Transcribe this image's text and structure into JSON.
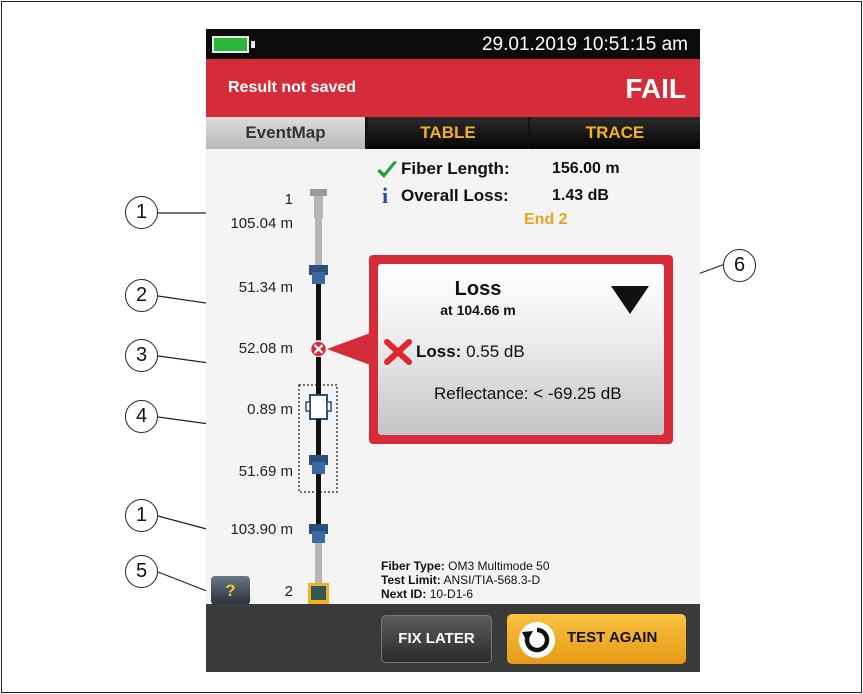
{
  "status": {
    "datetime": "29.01.2019 10:51:15 am",
    "battery_color": "#2bb53a"
  },
  "header": {
    "result_label": "Result not saved",
    "status_label": "FAIL",
    "status_color": "#d62c3a"
  },
  "tabs": [
    {
      "label": "EventMap",
      "active": true
    },
    {
      "label": "TABLE",
      "active": false
    },
    {
      "label": "TRACE",
      "active": false
    }
  ],
  "summary": {
    "fiber_length_label": "Fiber Length:",
    "fiber_length_value": "156.00 m",
    "overall_loss_label": "Overall Loss:",
    "overall_loss_value": "1.43 dB",
    "end_label": "End 2"
  },
  "event_map": {
    "top_end_number": "1",
    "bottom_end_number": "2",
    "segments": [
      "105.04 m",
      "51.34 m",
      "52.08 m",
      "0.89 m",
      "51.69 m",
      "103.90 m"
    ]
  },
  "event_popup": {
    "title": "Loss",
    "subtitle": "at 104.66 m",
    "loss_label": "Loss:",
    "loss_value": "0.55 dB",
    "reflectance": "Reflectance: < -69.25 dB"
  },
  "fiber_info": {
    "type_label": "Fiber Type:",
    "type_value": "OM3 Multimode 50",
    "limit_label": "Test Limit:",
    "limit_value": "ANSI/TIA-568.3-D",
    "next_id_label": "Next ID:",
    "next_id_value": "10-D1-6"
  },
  "help_label": "?",
  "buttons": {
    "fix_later": "FIX LATER",
    "test_again": "TEST AGAIN"
  },
  "callouts": [
    "1",
    "2",
    "3",
    "4",
    "1",
    "5",
    "6"
  ]
}
